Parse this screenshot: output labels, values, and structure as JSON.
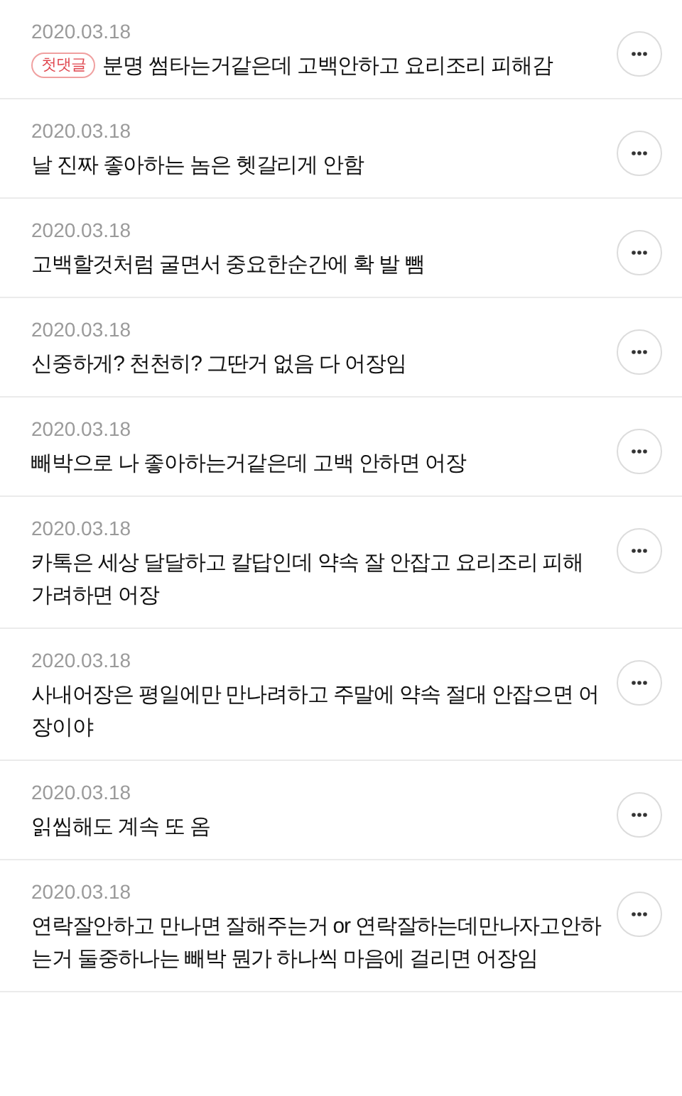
{
  "comments": [
    {
      "date": "2020.03.18",
      "badge": "첫댓글",
      "text": "분명 썸타는거같은데 고백안하고 요리조리 피해감"
    },
    {
      "date": "2020.03.18",
      "text": "날 진짜 좋아하는 놈은 헷갈리게 안함"
    },
    {
      "date": "2020.03.18",
      "text": "고백할것처럼 굴면서 중요한순간에 확 발 뺌"
    },
    {
      "date": "2020.03.18",
      "text": "신중하게? 천천히? 그딴거 없음 다 어장임"
    },
    {
      "date": "2020.03.18",
      "text": "빼박으로 나 좋아하는거같은데 고백 안하면 어장"
    },
    {
      "date": "2020.03.18",
      "text": "카톡은 세상 달달하고 칼답인데 약속 잘 안잡고 요리조리 피해 가려하면 어장"
    },
    {
      "date": "2020.03.18",
      "text": "사내어장은 평일에만 만나려하고 주말에 약속 절대 안잡으면 어장이야"
    },
    {
      "date": "2020.03.18",
      "text": "읽씹해도 계속 또 옴"
    },
    {
      "date": "2020.03.18",
      "text": "연락잘안하고 만나면 잘해주는거 or 연락잘하는데만나자고안하는거 둘중하나는 빼박 뭔가 하나씩 마음에 걸리면 어장임"
    }
  ]
}
